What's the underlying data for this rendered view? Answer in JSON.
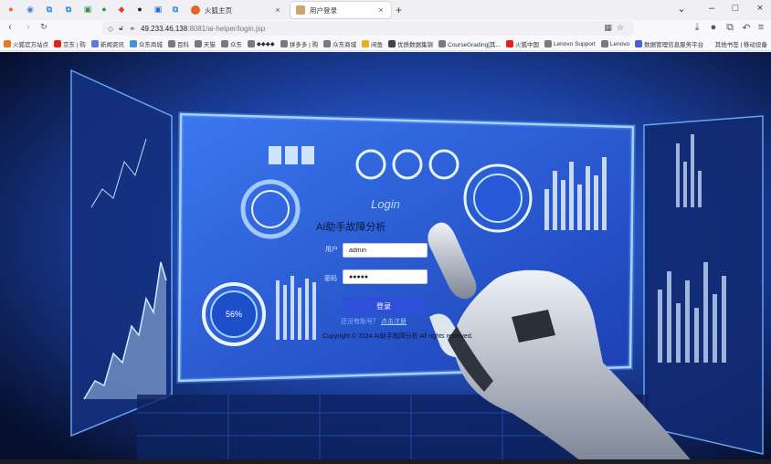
{
  "tabs": {
    "inactive": {
      "title": "火狐主页"
    },
    "active": {
      "title": "用户登录"
    }
  },
  "navbar": {
    "url_host": "49.233.46.138",
    "url_path": ":8081/ai-helper/login.jsp"
  },
  "bookmarks": {
    "items": [
      {
        "label": "火狐官方站点",
        "color": "#e87722"
      },
      {
        "label": "京东 | 购",
        "color": "#e1251b"
      },
      {
        "label": "新闻资讯",
        "color": "#5a7bd8"
      },
      {
        "label": "众东商城",
        "color": "#4a90e2"
      },
      {
        "label": "百科",
        "color": "#7a7a7a"
      },
      {
        "label": "天猫",
        "color": "#7a7a7a"
      },
      {
        "label": "众东",
        "color": "#7a7a7a"
      },
      {
        "label": "◆◆◆◆",
        "color": "#7a7a7a"
      },
      {
        "label": "拼多多 | 购",
        "color": "#7a7a7a"
      },
      {
        "label": "众东商城",
        "color": "#7a7a7a"
      },
      {
        "label": "闲鱼",
        "color": "#e3b21b"
      },
      {
        "label": "优质数据集锦",
        "color": "#444444"
      },
      {
        "label": "CourseGrading[其...",
        "color": "#7a7a7a"
      },
      {
        "label": "火狐中国",
        "color": "#e1251b"
      },
      {
        "label": "Lenovo Support",
        "color": "#7a7a7a"
      },
      {
        "label": "Lenovo",
        "color": "#7a7a7a"
      },
      {
        "label": "数据管理信息服务平台",
        "color": "#4a5fd1"
      }
    ],
    "right_label": "其他书签 | 移动设备"
  },
  "login": {
    "title": "AI助手故障分析",
    "username_label": "用户",
    "username_value": "admin",
    "password_label": "密码",
    "password_value": "●●●●●",
    "submit_label": "登录",
    "register_prompt": "还没有账号？",
    "register_link": "点击注册",
    "copyright": "Copyright © 2024 AI助手故障分析 All rights reserved."
  },
  "background_art": {
    "chart_badge_percent": "56%",
    "panel_title": "Login"
  },
  "colors": {
    "accent": "#2f4fd8",
    "background": "#0a1e55",
    "panel_glow": "#5fa8ff"
  }
}
